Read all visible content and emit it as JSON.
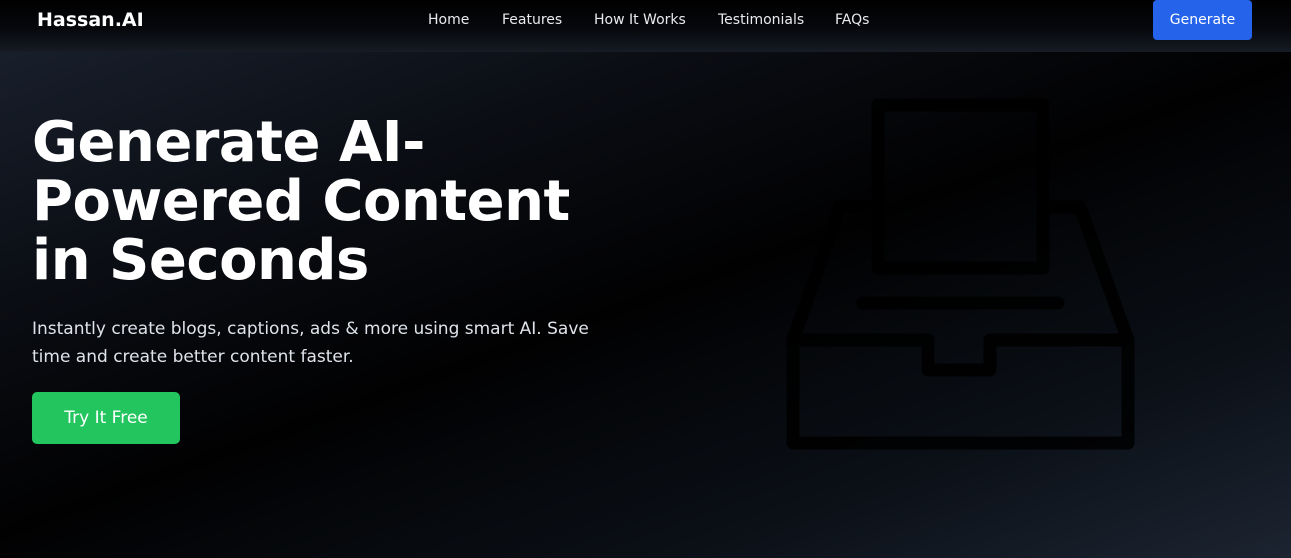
{
  "header": {
    "brand": "Hassan.AI",
    "nav": [
      {
        "label": "Home"
      },
      {
        "label": "Features"
      },
      {
        "label": "How It Works"
      },
      {
        "label": "Testimonials"
      },
      {
        "label": "FAQs"
      }
    ],
    "generate_label": "Generate"
  },
  "hero": {
    "title_lines": [
      "Generate AI-",
      "Powered Content",
      "in Seconds"
    ],
    "subtitle": "Instantly create blogs, captions, ads & more using smart AI. Save time and create better content faster.",
    "cta_label": "Try It Free",
    "illustration_icon": "inbox-tray-icon"
  },
  "colors": {
    "primary_blue": "#2563eb",
    "cta_green": "#22c55e",
    "background_dark": "#010102"
  }
}
